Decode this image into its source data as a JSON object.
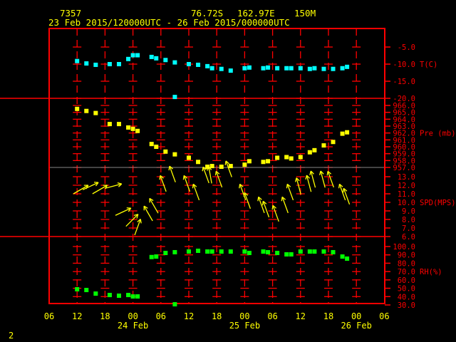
{
  "header": {
    "station": "7357",
    "lat": "76.72S",
    "lon": "162.97E",
    "elev": "150M",
    "range": "23 Feb 2015/120000UTC - 26 Feb 2015/000000UTC"
  },
  "footer": {
    "page": "2"
  },
  "colors": {
    "axis": "#ff0000",
    "text": "#ffff00",
    "temp": "#00ffff",
    "pres": "#ffff00",
    "wind": "#ffff00",
    "rh": "#00ff00"
  },
  "chart_data": {
    "type": "scatter",
    "title": "7357 76.72S 162.97E 150M",
    "x_unit": "hours since 23 Feb 2015 12UTC",
    "xlim": [
      -6,
      66
    ],
    "x_ticks": [
      {
        "h": -6,
        "label": "06"
      },
      {
        "h": 0,
        "label": "12"
      },
      {
        "h": 6,
        "label": "18"
      },
      {
        "h": 12,
        "label": "00"
      },
      {
        "h": 18,
        "label": "06"
      },
      {
        "h": 24,
        "label": "12"
      },
      {
        "h": 30,
        "label": "18"
      },
      {
        "h": 36,
        "label": "00"
      },
      {
        "h": 42,
        "label": "06"
      },
      {
        "h": 48,
        "label": "12"
      },
      {
        "h": 54,
        "label": "18"
      },
      {
        "h": 60,
        "label": "00"
      },
      {
        "h": 66,
        "label": "06"
      }
    ],
    "date_labels": [
      {
        "h": 12,
        "label": "24 Feb"
      },
      {
        "h": 36,
        "label": "25 Feb"
      },
      {
        "h": 60,
        "label": "26 Feb"
      }
    ],
    "panels": [
      {
        "key": "temp",
        "label": "T(C)",
        "ylim": [
          -20,
          -5
        ],
        "ticks": [
          {
            "v": -5,
            "label": "-5.0"
          },
          {
            "v": -10,
            "label": "-10.0"
          },
          {
            "v": -15,
            "label": "-15.0"
          },
          {
            "v": -20,
            "label": "-20.0"
          }
        ],
        "label_at": -10,
        "points": [
          [
            0,
            -9.1
          ],
          [
            2,
            -9.8
          ],
          [
            4,
            -10.2
          ],
          [
            7,
            -10.0
          ],
          [
            9,
            -10.0
          ],
          [
            11,
            -8.5
          ],
          [
            12,
            -7.4
          ],
          [
            13,
            -7.4
          ],
          [
            16,
            -7.9
          ],
          [
            17,
            -8.3
          ],
          [
            19,
            -8.8
          ],
          [
            21,
            -9.5
          ],
          [
            21,
            -19.6
          ],
          [
            24,
            -10.0
          ],
          [
            26,
            -10.2
          ],
          [
            28,
            -10.6
          ],
          [
            29,
            -11.2
          ],
          [
            31,
            -11.4
          ],
          [
            33,
            -11.9
          ],
          [
            36,
            -11.2
          ],
          [
            37,
            -11.0
          ],
          [
            40,
            -11.2
          ],
          [
            41,
            -11.0
          ],
          [
            43,
            -11.2
          ],
          [
            45,
            -11.2
          ],
          [
            46,
            -11.2
          ],
          [
            48,
            -11.2
          ],
          [
            50,
            -11.4
          ],
          [
            51,
            -11.2
          ],
          [
            53,
            -11.4
          ],
          [
            55,
            -11.4
          ],
          [
            57,
            -11.2
          ],
          [
            58,
            -10.8
          ]
        ]
      },
      {
        "key": "pres",
        "label": "Pre (mb)",
        "ylim": [
          957,
          966
        ],
        "ticks": [
          {
            "v": 966,
            "label": "966.0"
          },
          {
            "v": 965,
            "label": "965.0"
          },
          {
            "v": 964,
            "label": "964.0"
          },
          {
            "v": 963,
            "label": "963.0"
          },
          {
            "v": 962,
            "label": "962.0"
          },
          {
            "v": 961,
            "label": "961.0"
          },
          {
            "v": 960,
            "label": "960.0"
          },
          {
            "v": 959,
            "label": "959.0"
          },
          {
            "v": 958,
            "label": "958.0"
          },
          {
            "v": 957,
            "label": "957.0"
          }
        ],
        "label_at": 962,
        "points": [
          [
            0,
            965.5
          ],
          [
            2,
            965.2
          ],
          [
            4,
            964.9
          ],
          [
            7,
            963.3
          ],
          [
            9,
            963.3
          ],
          [
            11,
            962.8
          ],
          [
            12,
            962.6
          ],
          [
            13,
            962.3
          ],
          [
            16,
            960.4
          ],
          [
            17,
            960.0
          ],
          [
            19,
            959.3
          ],
          [
            21,
            958.9
          ],
          [
            24,
            958.4
          ],
          [
            26,
            957.8
          ],
          [
            28,
            957.1
          ],
          [
            29,
            957.2
          ],
          [
            31,
            957.1
          ],
          [
            33,
            957.2
          ],
          [
            36,
            957.4
          ],
          [
            37,
            957.9
          ],
          [
            40,
            957.8
          ],
          [
            41,
            957.9
          ],
          [
            43,
            958.4
          ],
          [
            45,
            958.5
          ],
          [
            46,
            958.3
          ],
          [
            48,
            958.5
          ],
          [
            50,
            959.2
          ],
          [
            51,
            959.5
          ],
          [
            53,
            960.2
          ],
          [
            55,
            960.7
          ],
          [
            57,
            961.9
          ],
          [
            58,
            962.1
          ]
        ]
      },
      {
        "key": "wind",
        "label": "SPD(MPS)",
        "ylim": [
          6,
          13
        ],
        "ticks": [
          {
            "v": 13,
            "label": "13.0"
          },
          {
            "v": 12,
            "label": "12.0"
          },
          {
            "v": 11,
            "label": "11.0"
          },
          {
            "v": 10,
            "label": "10.0"
          },
          {
            "v": 9,
            "label": "9.0"
          },
          {
            "v": 8,
            "label": "8.0"
          },
          {
            "v": 7,
            "label": "7.0"
          },
          {
            "v": 6,
            "label": "6.0"
          }
        ],
        "label_at": 10,
        "points": [
          [
            0.8,
            11.5,
            60
          ],
          [
            2.9,
            11.9,
            65
          ],
          [
            4.9,
            11.5,
            60
          ],
          [
            7.8,
            11.9,
            75
          ],
          [
            9.9,
            8.9,
            65
          ],
          [
            11.8,
            7.9,
            45
          ],
          [
            13,
            7.1,
            20
          ],
          [
            15.3,
            8.7,
            330
          ],
          [
            16.5,
            9.6,
            330
          ],
          [
            18.5,
            12.2,
            340
          ],
          [
            20.5,
            13.3,
            340
          ],
          [
            23.6,
            12.2,
            340
          ],
          [
            25.6,
            11.2,
            340
          ],
          [
            27.7,
            13.2,
            340
          ],
          [
            28.6,
            13.2,
            350
          ],
          [
            30.5,
            12.7,
            340
          ],
          [
            32.6,
            13.9,
            340
          ],
          [
            35.6,
            11.2,
            340
          ],
          [
            36.6,
            10.2,
            340
          ],
          [
            39.6,
            9.7,
            340
          ],
          [
            40.6,
            9.2,
            340
          ],
          [
            42.7,
            8.7,
            340
          ],
          [
            44.7,
            9.7,
            340
          ],
          [
            45.8,
            11.2,
            340
          ],
          [
            47.6,
            11.9,
            345
          ],
          [
            49.8,
            12.2,
            345
          ],
          [
            50.7,
            12.7,
            345
          ],
          [
            52.8,
            12.7,
            345
          ],
          [
            54.5,
            12.7,
            340
          ],
          [
            57,
            11.2,
            340
          ],
          [
            57.9,
            10.7,
            340
          ]
        ]
      },
      {
        "key": "rh",
        "label": "RH(%)",
        "ylim": [
          30,
          100
        ],
        "ticks": [
          {
            "v": 100,
            "label": "100.0"
          },
          {
            "v": 90,
            "label": "90.0"
          },
          {
            "v": 80,
            "label": "80.0"
          },
          {
            "v": 70,
            "label": "70.0"
          },
          {
            "v": 60,
            "label": "60.0"
          },
          {
            "v": 50,
            "label": "50.0"
          },
          {
            "v": 40,
            "label": "40.0"
          },
          {
            "v": 30,
            "label": "30.0"
          }
        ],
        "label_at": 70,
        "points": [
          [
            0,
            48.8
          ],
          [
            2,
            47.9
          ],
          [
            4,
            43.6
          ],
          [
            7,
            41.9
          ],
          [
            9,
            41.1
          ],
          [
            11,
            41.9
          ],
          [
            12,
            40.2
          ],
          [
            13,
            40.2
          ],
          [
            16,
            87.4
          ],
          [
            17,
            88.0
          ],
          [
            19,
            92.3
          ],
          [
            21,
            93.2
          ],
          [
            21,
            30.8
          ],
          [
            24,
            94.0
          ],
          [
            26,
            94.9
          ],
          [
            28,
            94.0
          ],
          [
            29,
            94.0
          ],
          [
            31,
            94.0
          ],
          [
            33,
            94.0
          ],
          [
            36,
            94.0
          ],
          [
            37,
            92.3
          ],
          [
            40,
            94.0
          ],
          [
            41,
            93.2
          ],
          [
            43,
            92.3
          ],
          [
            45,
            90.6
          ],
          [
            46,
            90.6
          ],
          [
            48,
            94.0
          ],
          [
            50,
            94.0
          ],
          [
            51,
            94.0
          ],
          [
            53,
            94.0
          ],
          [
            55,
            93.2
          ],
          [
            57,
            88.0
          ],
          [
            58,
            85.5
          ]
        ]
      }
    ]
  }
}
